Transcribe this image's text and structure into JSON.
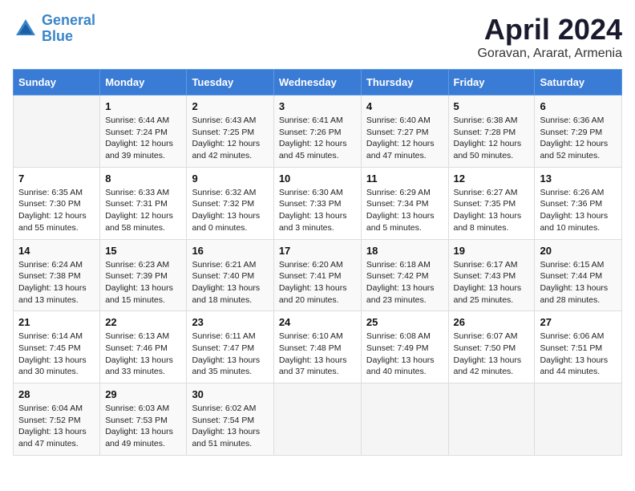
{
  "logo": {
    "line1": "General",
    "line2": "Blue"
  },
  "title": "April 2024",
  "subtitle": "Goravan, Ararat, Armenia",
  "header": {
    "days": [
      "Sunday",
      "Monday",
      "Tuesday",
      "Wednesday",
      "Thursday",
      "Friday",
      "Saturday"
    ]
  },
  "weeks": [
    [
      {
        "day": "",
        "sunrise": "",
        "sunset": "",
        "daylight": ""
      },
      {
        "day": "1",
        "sunrise": "Sunrise: 6:44 AM",
        "sunset": "Sunset: 7:24 PM",
        "daylight": "Daylight: 12 hours and 39 minutes."
      },
      {
        "day": "2",
        "sunrise": "Sunrise: 6:43 AM",
        "sunset": "Sunset: 7:25 PM",
        "daylight": "Daylight: 12 hours and 42 minutes."
      },
      {
        "day": "3",
        "sunrise": "Sunrise: 6:41 AM",
        "sunset": "Sunset: 7:26 PM",
        "daylight": "Daylight: 12 hours and 45 minutes."
      },
      {
        "day": "4",
        "sunrise": "Sunrise: 6:40 AM",
        "sunset": "Sunset: 7:27 PM",
        "daylight": "Daylight: 12 hours and 47 minutes."
      },
      {
        "day": "5",
        "sunrise": "Sunrise: 6:38 AM",
        "sunset": "Sunset: 7:28 PM",
        "daylight": "Daylight: 12 hours and 50 minutes."
      },
      {
        "day": "6",
        "sunrise": "Sunrise: 6:36 AM",
        "sunset": "Sunset: 7:29 PM",
        "daylight": "Daylight: 12 hours and 52 minutes."
      }
    ],
    [
      {
        "day": "7",
        "sunrise": "Sunrise: 6:35 AM",
        "sunset": "Sunset: 7:30 PM",
        "daylight": "Daylight: 12 hours and 55 minutes."
      },
      {
        "day": "8",
        "sunrise": "Sunrise: 6:33 AM",
        "sunset": "Sunset: 7:31 PM",
        "daylight": "Daylight: 12 hours and 58 minutes."
      },
      {
        "day": "9",
        "sunrise": "Sunrise: 6:32 AM",
        "sunset": "Sunset: 7:32 PM",
        "daylight": "Daylight: 13 hours and 0 minutes."
      },
      {
        "day": "10",
        "sunrise": "Sunrise: 6:30 AM",
        "sunset": "Sunset: 7:33 PM",
        "daylight": "Daylight: 13 hours and 3 minutes."
      },
      {
        "day": "11",
        "sunrise": "Sunrise: 6:29 AM",
        "sunset": "Sunset: 7:34 PM",
        "daylight": "Daylight: 13 hours and 5 minutes."
      },
      {
        "day": "12",
        "sunrise": "Sunrise: 6:27 AM",
        "sunset": "Sunset: 7:35 PM",
        "daylight": "Daylight: 13 hours and 8 minutes."
      },
      {
        "day": "13",
        "sunrise": "Sunrise: 6:26 AM",
        "sunset": "Sunset: 7:36 PM",
        "daylight": "Daylight: 13 hours and 10 minutes."
      }
    ],
    [
      {
        "day": "14",
        "sunrise": "Sunrise: 6:24 AM",
        "sunset": "Sunset: 7:38 PM",
        "daylight": "Daylight: 13 hours and 13 minutes."
      },
      {
        "day": "15",
        "sunrise": "Sunrise: 6:23 AM",
        "sunset": "Sunset: 7:39 PM",
        "daylight": "Daylight: 13 hours and 15 minutes."
      },
      {
        "day": "16",
        "sunrise": "Sunrise: 6:21 AM",
        "sunset": "Sunset: 7:40 PM",
        "daylight": "Daylight: 13 hours and 18 minutes."
      },
      {
        "day": "17",
        "sunrise": "Sunrise: 6:20 AM",
        "sunset": "Sunset: 7:41 PM",
        "daylight": "Daylight: 13 hours and 20 minutes."
      },
      {
        "day": "18",
        "sunrise": "Sunrise: 6:18 AM",
        "sunset": "Sunset: 7:42 PM",
        "daylight": "Daylight: 13 hours and 23 minutes."
      },
      {
        "day": "19",
        "sunrise": "Sunrise: 6:17 AM",
        "sunset": "Sunset: 7:43 PM",
        "daylight": "Daylight: 13 hours and 25 minutes."
      },
      {
        "day": "20",
        "sunrise": "Sunrise: 6:15 AM",
        "sunset": "Sunset: 7:44 PM",
        "daylight": "Daylight: 13 hours and 28 minutes."
      }
    ],
    [
      {
        "day": "21",
        "sunrise": "Sunrise: 6:14 AM",
        "sunset": "Sunset: 7:45 PM",
        "daylight": "Daylight: 13 hours and 30 minutes."
      },
      {
        "day": "22",
        "sunrise": "Sunrise: 6:13 AM",
        "sunset": "Sunset: 7:46 PM",
        "daylight": "Daylight: 13 hours and 33 minutes."
      },
      {
        "day": "23",
        "sunrise": "Sunrise: 6:11 AM",
        "sunset": "Sunset: 7:47 PM",
        "daylight": "Daylight: 13 hours and 35 minutes."
      },
      {
        "day": "24",
        "sunrise": "Sunrise: 6:10 AM",
        "sunset": "Sunset: 7:48 PM",
        "daylight": "Daylight: 13 hours and 37 minutes."
      },
      {
        "day": "25",
        "sunrise": "Sunrise: 6:08 AM",
        "sunset": "Sunset: 7:49 PM",
        "daylight": "Daylight: 13 hours and 40 minutes."
      },
      {
        "day": "26",
        "sunrise": "Sunrise: 6:07 AM",
        "sunset": "Sunset: 7:50 PM",
        "daylight": "Daylight: 13 hours and 42 minutes."
      },
      {
        "day": "27",
        "sunrise": "Sunrise: 6:06 AM",
        "sunset": "Sunset: 7:51 PM",
        "daylight": "Daylight: 13 hours and 44 minutes."
      }
    ],
    [
      {
        "day": "28",
        "sunrise": "Sunrise: 6:04 AM",
        "sunset": "Sunset: 7:52 PM",
        "daylight": "Daylight: 13 hours and 47 minutes."
      },
      {
        "day": "29",
        "sunrise": "Sunrise: 6:03 AM",
        "sunset": "Sunset: 7:53 PM",
        "daylight": "Daylight: 13 hours and 49 minutes."
      },
      {
        "day": "30",
        "sunrise": "Sunrise: 6:02 AM",
        "sunset": "Sunset: 7:54 PM",
        "daylight": "Daylight: 13 hours and 51 minutes."
      },
      {
        "day": "",
        "sunrise": "",
        "sunset": "",
        "daylight": ""
      },
      {
        "day": "",
        "sunrise": "",
        "sunset": "",
        "daylight": ""
      },
      {
        "day": "",
        "sunrise": "",
        "sunset": "",
        "daylight": ""
      },
      {
        "day": "",
        "sunrise": "",
        "sunset": "",
        "daylight": ""
      }
    ]
  ]
}
